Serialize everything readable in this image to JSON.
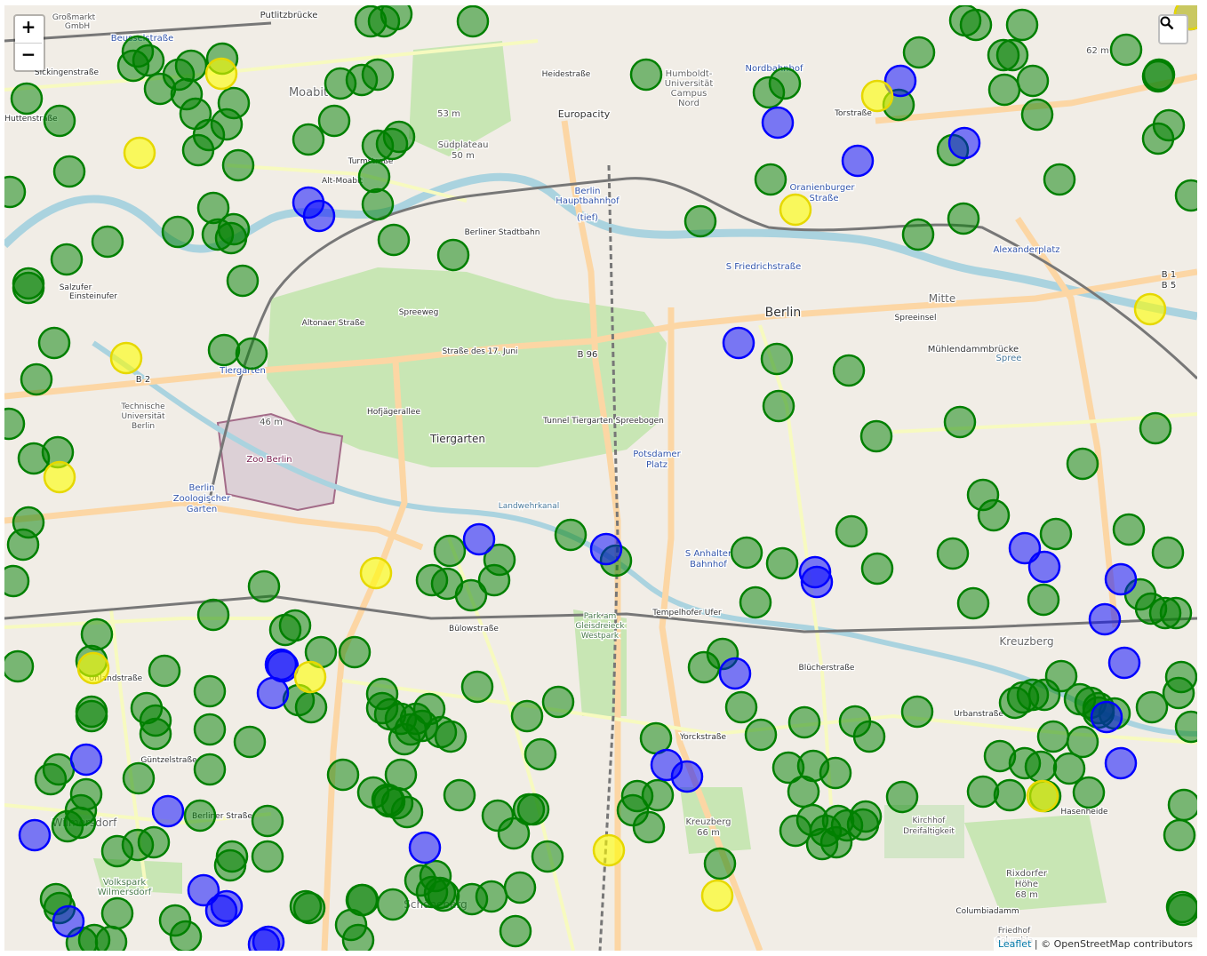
{
  "controls": {
    "zoom_in": "+",
    "zoom_out": "−",
    "search_icon": "magnifier-icon"
  },
  "attribution": {
    "leaflet": "Leaflet",
    "separator": " | © ",
    "osm": "OpenStreetMap contributors"
  },
  "colors": {
    "land": "#f1ede6",
    "park": "#c8e6b4",
    "water": "#aad3df",
    "green": "#008000",
    "blue": "#0000ff",
    "yellow": "#ffff00"
  },
  "labels": {
    "putlitz": "Putlitzbrücke",
    "grossmarkt": "Großmarkt",
    "gmbh": "GmbH",
    "beussel": "Beusselstraße",
    "moabit": "Moabit",
    "sickingen": "Sickingenstraße",
    "huttenstr": "Huttenstraße",
    "humboldt": "Humboldt-",
    "universitaet": "Universität",
    "campus": "Campus",
    "nord": "Nord",
    "nordbahnhof": "Nordbahnhof",
    "europacity": "Europacity",
    "hauptbahnhof1": "Berlin",
    "hauptbahnhof2": "Hauptbahnhof",
    "tief": "(tief)",
    "turmstr": "Turmstraße",
    "altmoabit": "Alt-Moabit",
    "suedplateau": "Südplateau",
    "m50": "50 m",
    "m53": "53 m",
    "m62": "62 m",
    "torstr": "Torstraße",
    "oranienburger1": "Oranienburger",
    "oranienburger2": "Straße",
    "alexanderplatz": "Alexanderplatz",
    "friedrichstr": "S Friedrichstraße",
    "berlin": "Berlin",
    "mitte": "Mitte",
    "spreeinsel": "Spreeinsel",
    "muehlendamm": "Mühlendammbrücke",
    "b1": "B 1",
    "b5": "B 5",
    "b2": "B 2",
    "b96": "B 96",
    "strasse17juni": "Straße des 17. Juni",
    "tiergarten": "Tiergarten",
    "tiergarten_park": "Tiergarten",
    "tu1": "Technische",
    "tu2": "Universität",
    "tu3": "Berlin",
    "zoo": "Zoo Berlin",
    "zoologischer1": "Berlin",
    "zoologischer2": "Zoologischer",
    "zoologischer3": "Garten",
    "m46": "46 m",
    "potsdamer1": "Potsdamer",
    "potsdamer2": "Platz",
    "anhalter1": "S Anhalter",
    "anhalter2": "Bahnhof",
    "landwehrkanal": "Landwehrkanal",
    "buelowstr": "Bülowstraße",
    "gleisdreieck1": "Park am",
    "gleisdreieck2": "Gleisdreieck",
    "gleisdreieck3": "Westpark",
    "tempelhofer": "Tempelhofer Ufer",
    "kreuzberg": "Kreuzberg",
    "bluecher": "Blücherstraße",
    "yorck": "Yorckstraße",
    "urban": "Urbanstraße",
    "kreuzberg_hill1": "Kreuzberg",
    "kreuzberg_hill2": "66 m",
    "kirchhof1": "Kirchhof",
    "kirchhof2": "Dreifaltigkeit",
    "rixdorf1": "Rixdorfer",
    "rixdorf2": "Höhe",
    "rixdorf3": "68 m",
    "columbia": "Columbiadamm",
    "hasenheide": "Hasenheide",
    "guentzel": "Güntzelstraße",
    "berlinerstr": "Berliner Straße",
    "uhland": "Uhlandstraße",
    "volkspark1": "Volkspark",
    "volkspark2": "Wilmersdorf",
    "schoeneberg": "Schöneberg",
    "wilmersdorf": "Wilmersdorf",
    "spree": "Spree",
    "altonaer": "Altonaer Straße",
    "hofjaeger": "Hofjägerallee",
    "salzufer": "Salzufer",
    "einsteinufer": "Einsteinufer",
    "spreeweg": "Spreeweg",
    "friedhof1": "Friedhof",
    "friedhof2": "Columbia",
    "tunnel": "Tunnel Tiergarten Spreebogen",
    "heidestr": "Heidestraße",
    "stadtbahn": "Berliner Stadtbahn"
  },
  "markers": [
    [
      "g",
      412,
      18
    ],
    [
      "g",
      427,
      18
    ],
    [
      "g",
      441,
      10
    ],
    [
      "g",
      527,
      18
    ],
    [
      "g",
      150,
      52
    ],
    [
      "g",
      162,
      62
    ],
    [
      "g",
      145,
      68
    ],
    [
      "g",
      175,
      94
    ],
    [
      "g",
      196,
      78
    ],
    [
      "g",
      210,
      68
    ],
    [
      "g",
      205,
      100
    ],
    [
      "g",
      215,
      122
    ],
    [
      "g",
      245,
      60
    ],
    [
      "g",
      258,
      110
    ],
    [
      "g",
      250,
      134
    ],
    [
      "g",
      230,
      146
    ],
    [
      "g",
      218,
      163
    ],
    [
      "g",
      263,
      180
    ],
    [
      "g",
      25,
      105
    ],
    [
      "g",
      62,
      130
    ],
    [
      "g",
      73,
      187
    ],
    [
      "g",
      6,
      210
    ],
    [
      "g",
      378,
      88
    ],
    [
      "g",
      402,
      84
    ],
    [
      "g",
      420,
      78
    ],
    [
      "g",
      371,
      130
    ],
    [
      "g",
      342,
      151
    ],
    [
      "g",
      420,
      158
    ],
    [
      "g",
      444,
      148
    ],
    [
      "g",
      436,
      156
    ],
    [
      "g",
      416,
      193
    ],
    [
      "g",
      420,
      224
    ],
    [
      "g",
      438,
      264
    ],
    [
      "g",
      505,
      281
    ],
    [
      "g",
      235,
      228
    ],
    [
      "g",
      258,
      252
    ],
    [
      "g",
      255,
      262
    ],
    [
      "g",
      240,
      258
    ],
    [
      "g",
      195,
      255
    ],
    [
      "g",
      116,
      266
    ],
    [
      "g",
      70,
      286
    ],
    [
      "g",
      27,
      318
    ],
    [
      "g",
      27,
      313
    ],
    [
      "g",
      268,
      310
    ],
    [
      "g",
      56,
      380
    ],
    [
      "g",
      36,
      421
    ],
    [
      "g",
      247,
      388
    ],
    [
      "g",
      278,
      392
    ],
    [
      "g",
      5,
      471
    ],
    [
      "g",
      33,
      510
    ],
    [
      "g",
      60,
      503
    ],
    [
      "g",
      27,
      582
    ],
    [
      "g",
      21,
      607
    ],
    [
      "g",
      10,
      648
    ],
    [
      "g",
      292,
      654
    ],
    [
      "g",
      235,
      686
    ],
    [
      "g",
      722,
      78
    ],
    [
      "g",
      1029,
      53
    ],
    [
      "g",
      1081,
      17
    ],
    [
      "g",
      1093,
      22
    ],
    [
      "g",
      1145,
      22
    ],
    [
      "g",
      1262,
      50
    ],
    [
      "g",
      1124,
      56
    ],
    [
      "g",
      1134,
      56
    ],
    [
      "g",
      1157,
      85
    ],
    [
      "g",
      1125,
      95
    ],
    [
      "g",
      1162,
      123
    ],
    [
      "g",
      1298,
      80
    ],
    [
      "g",
      1299,
      78
    ],
    [
      "g",
      1310,
      135
    ],
    [
      "g",
      1298,
      150
    ],
    [
      "g",
      1187,
      196
    ],
    [
      "g",
      1335,
      214
    ],
    [
      "g",
      1067,
      163
    ],
    [
      "g",
      1079,
      240
    ],
    [
      "g",
      1028,
      258
    ],
    [
      "g",
      860,
      98
    ],
    [
      "g",
      878,
      88
    ],
    [
      "g",
      862,
      196
    ],
    [
      "g",
      783,
      243
    ],
    [
      "g",
      1006,
      112
    ],
    [
      "g",
      869,
      398
    ],
    [
      "g",
      950,
      411
    ],
    [
      "g",
      871,
      451
    ],
    [
      "g",
      981,
      485
    ],
    [
      "g",
      1075,
      469
    ],
    [
      "g",
      1295,
      476
    ],
    [
      "g",
      1213,
      516
    ],
    [
      "g",
      1101,
      551
    ],
    [
      "g",
      1113,
      574
    ],
    [
      "g",
      1183,
      595
    ],
    [
      "g",
      1265,
      590
    ],
    [
      "g",
      1309,
      616
    ],
    [
      "g",
      1067,
      617
    ],
    [
      "g",
      1090,
      673
    ],
    [
      "g",
      1169,
      669
    ],
    [
      "g",
      1278,
      663
    ],
    [
      "g",
      1290,
      679
    ],
    [
      "g",
      1306,
      684
    ],
    [
      "g",
      1318,
      684
    ],
    [
      "g",
      953,
      592
    ],
    [
      "g",
      982,
      634
    ],
    [
      "g",
      875,
      628
    ],
    [
      "g",
      835,
      616
    ],
    [
      "g",
      845,
      672
    ],
    [
      "g",
      637,
      596
    ],
    [
      "g",
      688,
      625
    ],
    [
      "g",
      501,
      614
    ],
    [
      "g",
      557,
      624
    ],
    [
      "g",
      551,
      647
    ],
    [
      "g",
      481,
      647
    ],
    [
      "g",
      498,
      651
    ],
    [
      "g",
      525,
      664
    ],
    [
      "g",
      327,
      698
    ],
    [
      "g",
      316,
      703
    ],
    [
      "g",
      356,
      728
    ],
    [
      "g",
      394,
      728
    ],
    [
      "g",
      104,
      708
    ],
    [
      "g",
      98,
      738
    ],
    [
      "g",
      15,
      744
    ],
    [
      "g",
      180,
      749
    ],
    [
      "g",
      231,
      772
    ],
    [
      "g",
      98,
      800
    ],
    [
      "g",
      98,
      795
    ],
    [
      "g",
      160,
      791
    ],
    [
      "g",
      170,
      820
    ],
    [
      "g",
      170,
      805
    ],
    [
      "g",
      231,
      815
    ],
    [
      "g",
      276,
      829
    ],
    [
      "g",
      345,
      790
    ],
    [
      "g",
      331,
      782
    ],
    [
      "g",
      425,
      775
    ],
    [
      "g",
      532,
      767
    ],
    [
      "g",
      588,
      800
    ],
    [
      "g",
      623,
      784
    ],
    [
      "g",
      603,
      843
    ],
    [
      "g",
      381,
      866
    ],
    [
      "g",
      446,
      866
    ],
    [
      "g",
      415,
      886
    ],
    [
      "g",
      433,
      896
    ],
    [
      "g",
      453,
      908
    ],
    [
      "g",
      442,
      898
    ],
    [
      "g",
      431,
      894
    ],
    [
      "g",
      512,
      889
    ],
    [
      "g",
      555,
      912
    ],
    [
      "g",
      573,
      932
    ],
    [
      "g",
      595,
      905
    ],
    [
      "g",
      590,
      905
    ],
    [
      "g",
      611,
      958
    ],
    [
      "g",
      580,
      993
    ],
    [
      "g",
      575,
      1042
    ],
    [
      "g",
      548,
      1003
    ],
    [
      "g",
      526,
      1006
    ],
    [
      "g",
      494,
      1002
    ],
    [
      "g",
      481,
      998
    ],
    [
      "g",
      468,
      985
    ],
    [
      "g",
      402,
      1007
    ],
    [
      "g",
      390,
      1035
    ],
    [
      "g",
      398,
      1052
    ],
    [
      "g",
      339,
      1014
    ],
    [
      "g",
      296,
      918
    ],
    [
      "g",
      296,
      958
    ],
    [
      "g",
      256,
      958
    ],
    [
      "g",
      254,
      968
    ],
    [
      "g",
      220,
      912
    ],
    [
      "g",
      231,
      860
    ],
    [
      "g",
      151,
      870
    ],
    [
      "g",
      61,
      860
    ],
    [
      "g",
      52,
      871
    ],
    [
      "g",
      92,
      888
    ],
    [
      "g",
      86,
      906
    ],
    [
      "g",
      71,
      924
    ],
    [
      "g",
      85,
      920
    ],
    [
      "g",
      127,
      952
    ],
    [
      "g",
      150,
      945
    ],
    [
      "g",
      168,
      942
    ],
    [
      "g",
      192,
      1030
    ],
    [
      "g",
      204,
      1048
    ],
    [
      "g",
      127,
      1022
    ],
    [
      "g",
      101,
      1052
    ],
    [
      "g",
      120,
      1054
    ],
    [
      "g",
      87,
      1055
    ],
    [
      "g",
      58,
      1006
    ],
    [
      "g",
      62,
      1016
    ],
    [
      "g",
      425,
      791
    ],
    [
      "g",
      434,
      798
    ],
    [
      "g",
      446,
      803
    ],
    [
      "g",
      463,
      803
    ],
    [
      "g",
      470,
      811
    ],
    [
      "g",
      457,
      815
    ],
    [
      "g",
      478,
      792
    ],
    [
      "g",
      491,
      818
    ],
    [
      "g",
      502,
      823
    ],
    [
      "g",
      450,
      826
    ],
    [
      "g",
      733,
      825
    ],
    [
      "g",
      787,
      745
    ],
    [
      "g",
      808,
      730
    ],
    [
      "g",
      829,
      790
    ],
    [
      "g",
      851,
      821
    ],
    [
      "g",
      900,
      807
    ],
    [
      "g",
      957,
      806
    ],
    [
      "g",
      973,
      823
    ],
    [
      "g",
      1027,
      795
    ],
    [
      "g",
      1137,
      785
    ],
    [
      "g",
      1146,
      779
    ],
    [
      "g",
      1157,
      776
    ],
    [
      "g",
      1170,
      776
    ],
    [
      "g",
      1189,
      755
    ],
    [
      "g",
      1210,
      781
    ],
    [
      "g",
      1231,
      791
    ],
    [
      "g",
      1249,
      797
    ],
    [
      "g",
      1231,
      796
    ],
    [
      "g",
      1222,
      785
    ],
    [
      "g",
      1291,
      790
    ],
    [
      "g",
      1324,
      756
    ],
    [
      "g",
      1321,
      774
    ],
    [
      "g",
      1335,
      812
    ],
    [
      "g",
      1180,
      823
    ],
    [
      "g",
      1213,
      829
    ],
    [
      "g",
      1120,
      845
    ],
    [
      "g",
      1148,
      853
    ],
    [
      "g",
      1166,
      857
    ],
    [
      "g",
      1198,
      859
    ],
    [
      "g",
      1220,
      886
    ],
    [
      "g",
      1327,
      900
    ],
    [
      "g",
      1322,
      934
    ],
    [
      "g",
      1101,
      885
    ],
    [
      "g",
      1131,
      889
    ],
    [
      "g",
      1171,
      890
    ],
    [
      "g",
      1010,
      891
    ],
    [
      "g",
      882,
      858
    ],
    [
      "g",
      910,
      856
    ],
    [
      "g",
      935,
      864
    ],
    [
      "g",
      899,
      885
    ],
    [
      "g",
      909,
      917
    ],
    [
      "g",
      924,
      929
    ],
    [
      "g",
      938,
      918
    ],
    [
      "g",
      948,
      923
    ],
    [
      "g",
      969,
      913
    ],
    [
      "g",
      966,
      922
    ],
    [
      "g",
      936,
      942
    ],
    [
      "g",
      920,
      944
    ],
    [
      "g",
      890,
      929
    ],
    [
      "g",
      712,
      890
    ],
    [
      "g",
      735,
      889
    ],
    [
      "g",
      707,
      906
    ],
    [
      "g",
      725,
      925
    ],
    [
      "g",
      805,
      966
    ],
    [
      "g",
      1326,
      1018
    ],
    [
      "g",
      1325,
      1015
    ],
    [
      "g",
      343,
      1016
    ],
    [
      "g",
      403,
      1007
    ],
    [
      "g",
      437,
      1012
    ],
    [
      "g",
      485,
      980
    ],
    [
      "g",
      490,
      999
    ],
    [
      "b",
      342,
      222
    ],
    [
      "b",
      354,
      237
    ],
    [
      "b",
      870,
      132
    ],
    [
      "b",
      1008,
      85
    ],
    [
      "b",
      960,
      175
    ],
    [
      "b",
      1080,
      155
    ],
    [
      "b",
      826,
      380
    ],
    [
      "b",
      534,
      601
    ],
    [
      "b",
      677,
      612
    ],
    [
      "b",
      912,
      638
    ],
    [
      "b",
      914,
      649
    ],
    [
      "b",
      1148,
      611
    ],
    [
      "b",
      1170,
      632
    ],
    [
      "b",
      1256,
      646
    ],
    [
      "b",
      1238,
      691
    ],
    [
      "b",
      1260,
      740
    ],
    [
      "b",
      1240,
      801
    ],
    [
      "b",
      1256,
      853
    ],
    [
      "b",
      822,
      752
    ],
    [
      "b",
      745,
      855
    ],
    [
      "b",
      768,
      868
    ],
    [
      "b",
      311,
      742
    ],
    [
      "b",
      313,
      744
    ],
    [
      "b",
      302,
      774
    ],
    [
      "b",
      92,
      849
    ],
    [
      "b",
      184,
      907
    ],
    [
      "b",
      34,
      934
    ],
    [
      "b",
      473,
      948
    ],
    [
      "b",
      224,
      996
    ],
    [
      "b",
      244,
      1019
    ],
    [
      "b",
      250,
      1014
    ],
    [
      "b",
      292,
      1057
    ],
    [
      "b",
      297,
      1054
    ],
    [
      "b",
      72,
      1031
    ],
    [
      "b",
      1334,
      10
    ],
    [
      "y",
      244,
      77
    ],
    [
      "y",
      152,
      166
    ],
    [
      "y",
      982,
      102
    ],
    [
      "y",
      890,
      230
    ],
    [
      "y",
      1289,
      342
    ],
    [
      "y",
      137,
      397
    ],
    [
      "y",
      62,
      531
    ],
    [
      "y",
      418,
      639
    ],
    [
      "y",
      100,
      746
    ],
    [
      "y",
      344,
      756
    ],
    [
      "y",
      1168,
      890
    ],
    [
      "y",
      680,
      951
    ],
    [
      "y",
      802,
      1002
    ],
    [
      "y",
      1334,
      10
    ]
  ]
}
